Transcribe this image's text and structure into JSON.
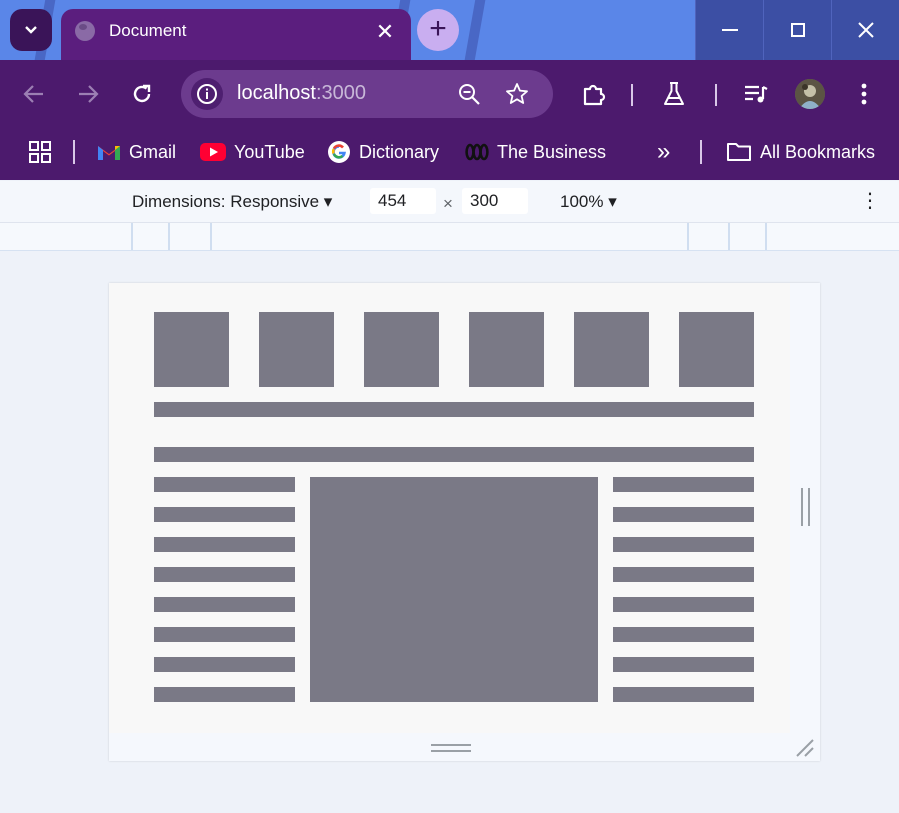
{
  "browser": {
    "tab": {
      "title": "Document",
      "close_glyph": "✕"
    },
    "new_tab_glyph": "+",
    "window_controls": {
      "minimize": "—",
      "maximize": "☐",
      "close": "✕"
    },
    "address": {
      "host": "localhost",
      "port": ":3000"
    },
    "bookmarks": [
      {
        "label": "Gmail",
        "icon": "gmail-icon"
      },
      {
        "label": "YouTube",
        "icon": "youtube-icon"
      },
      {
        "label": "Dictionary",
        "icon": "google-icon"
      },
      {
        "label": "The Business",
        "icon": "abc-icon"
      }
    ],
    "bookmarks_overflow": "»",
    "all_bookmarks": "All Bookmarks",
    "colors": {
      "tabstrip": "#5a86e8",
      "toolbar": "#4c1a6d",
      "active_tab": "#5b1e7e"
    }
  },
  "devtools": {
    "dimensions_label": "Dimensions: Responsive ▾",
    "width": "454",
    "height": "300",
    "times": "×",
    "zoom": "100% ▾",
    "more": "⋮"
  },
  "page": {
    "block_color": "#7a7986",
    "background": "#f8f8f8"
  }
}
